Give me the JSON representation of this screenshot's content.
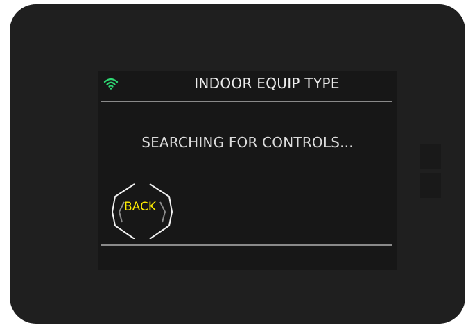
{
  "screen": {
    "title": "INDOOR EQUIP TYPE",
    "message": "SEARCHING FOR CONTROLS...",
    "wifi_icon": "wifi-icon",
    "wifi_color": "#2ed873"
  },
  "buttons": {
    "back_label": "BACK",
    "back_label_color": "#ffee00"
  }
}
